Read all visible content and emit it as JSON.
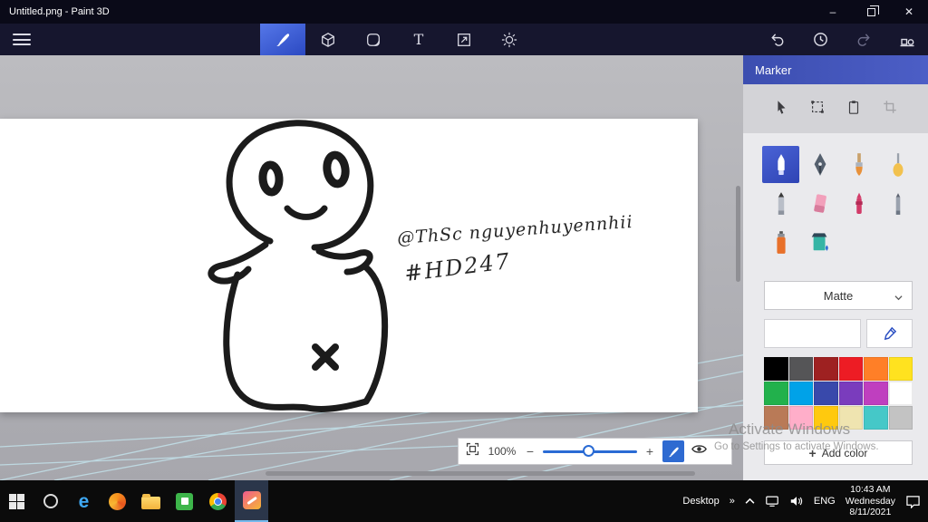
{
  "window": {
    "title": "Untitled.png - Paint 3D"
  },
  "icons": {
    "minimize": "–",
    "close": "✕",
    "text_tab": "T",
    "minus": "−",
    "plus": "+",
    "add": "+",
    "chevrons": "»",
    "edge": "e"
  },
  "canvas": {
    "annotation_line1": "@ThSc nguyenhuyennhii",
    "annotation_line2": "#HD247"
  },
  "panel": {
    "title": "Marker",
    "brushes": [
      "Marker",
      "Calligraphy pen",
      "Oil brush",
      "Watercolor",
      "Pencil",
      "Eraser",
      "Crayon",
      "Pixel pen",
      "Spray can",
      "Fill"
    ],
    "finish": "Matte",
    "add_color": "Add color",
    "accent": "#3b53c4",
    "colors": [
      "#000000",
      "#555557",
      "#9e2121",
      "#ed1c24",
      "#ff7f27",
      "#ffe21f",
      "#22b14c",
      "#00a2e8",
      "#3949ab",
      "#7a3cbd",
      "#bf3fbf",
      "#ffffff",
      "#b97a57",
      "#ffaec9",
      "#ffc90e",
      "#efe4b0",
      "#45c8c8",
      "#c3c3c3"
    ]
  },
  "zoombar": {
    "zoom": "100%"
  },
  "watermark": {
    "line1": "Activate Windows",
    "line2": "Go to Settings to activate Windows."
  },
  "taskbar": {
    "desktop": "Desktop",
    "language": "ENG",
    "time": "10:43 AM",
    "weekday": "Wednesday",
    "date": "8/11/2021"
  }
}
